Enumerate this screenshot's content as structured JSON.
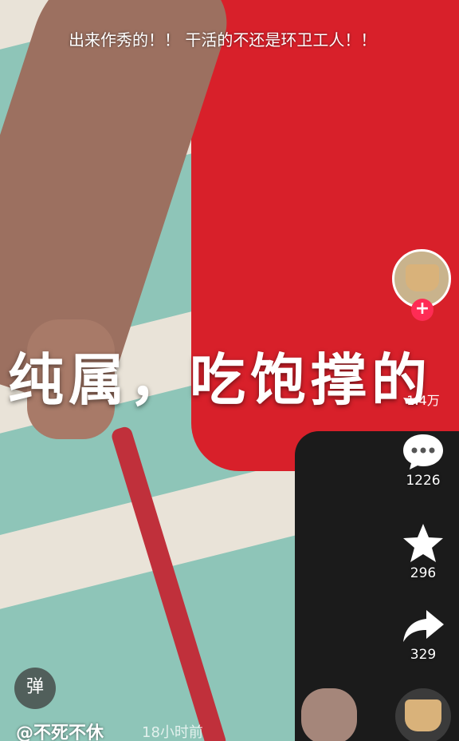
{
  "overlay_comment": "出来作秀的！！ 干活的不还是环卫工人！！",
  "caption": "纯属，吃饱撑的",
  "sidebar": {
    "follow_symbol": "+",
    "like_count": "1.4万",
    "comment_count": "1226",
    "favorite_count": "296",
    "share_count": "329"
  },
  "bottom": {
    "danmu_label": "弹",
    "author": "@不死不休",
    "time": "18小时前"
  },
  "icons": {
    "comment": "comment-bubble-icon",
    "favorite": "star-icon",
    "share": "share-arrow-icon"
  },
  "colors": {
    "accent": "#fe2c55",
    "shirt": "#d8202a"
  }
}
